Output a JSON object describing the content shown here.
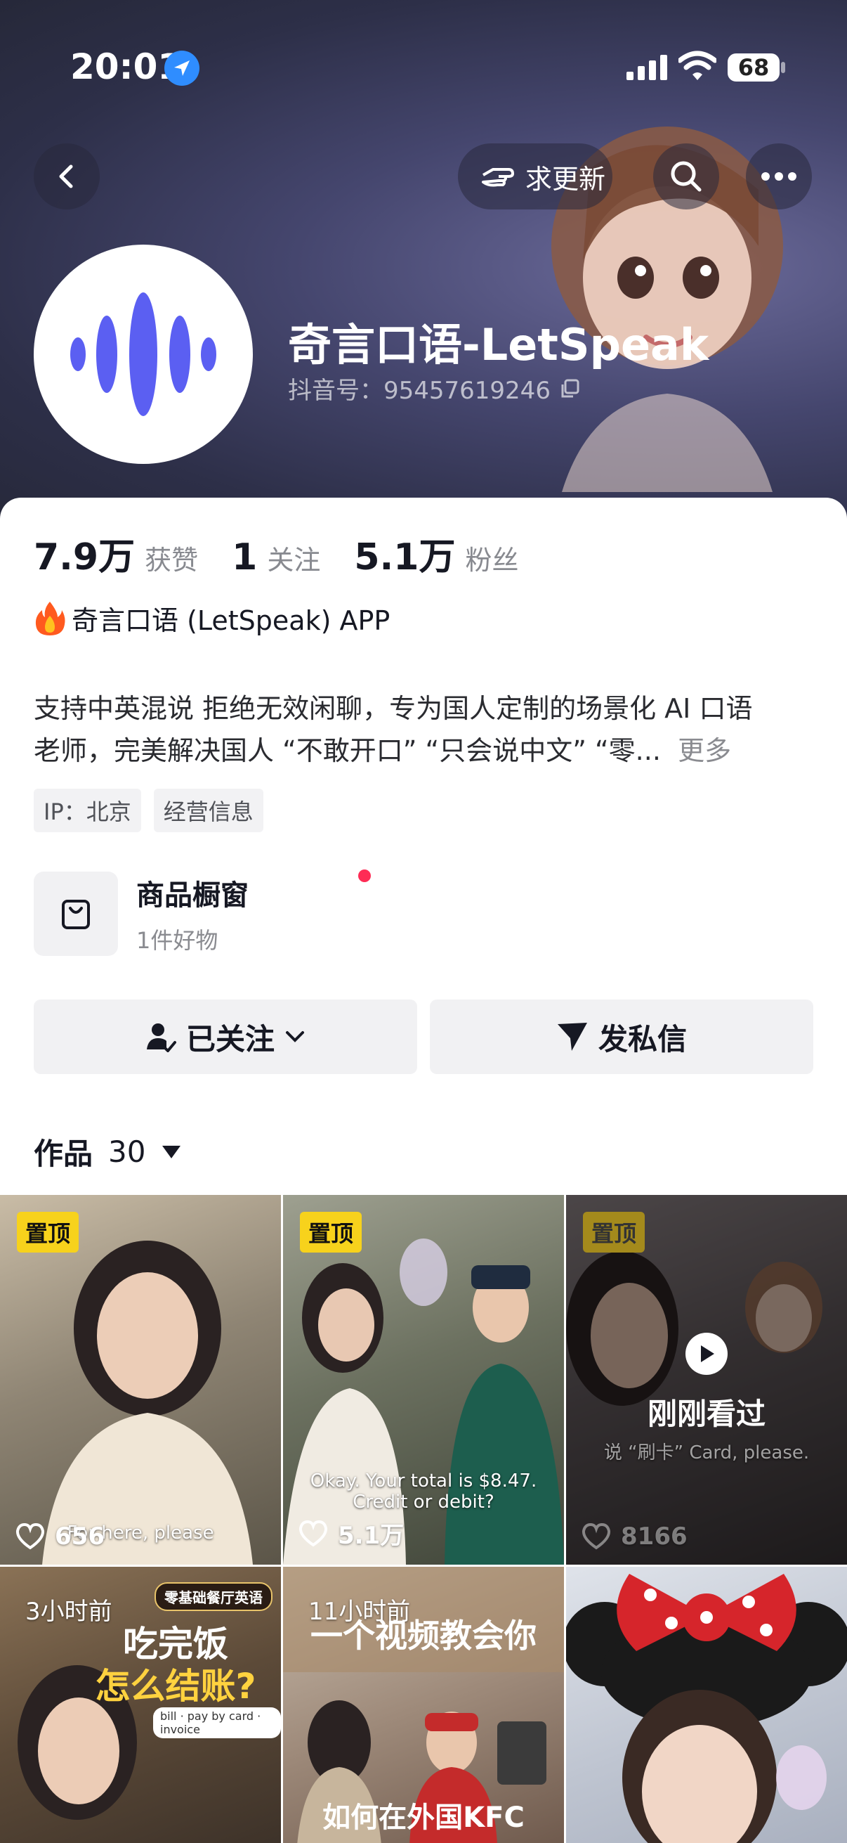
{
  "status": {
    "time": "20:01",
    "battery": "68"
  },
  "nav": {
    "update_label": "求更新"
  },
  "profile": {
    "name": "奇言口语-LetSpeak",
    "douyin_id": "抖音号：95457619246"
  },
  "stats": [
    {
      "num": "7.9万",
      "label": "获赞"
    },
    {
      "num": "1",
      "label": "关注"
    },
    {
      "num": "5.1万",
      "label": "粉丝"
    }
  ],
  "promo": "奇言口语 (LetSpeak) APP",
  "bio": {
    "line1": "支持中英混说 拒绝无效闲聊，专为国人定制的场景化 AI 口语",
    "line2": "老师，完美解决国人 “不敢开口” “只会说中文” “零...",
    "more": "更多"
  },
  "tags": [
    "IP：北京",
    "经营信息"
  ],
  "shop": {
    "title": "商品橱窗",
    "sub": "1件好物"
  },
  "actions": {
    "follow": "已关注",
    "message": "发私信"
  },
  "works": {
    "label": "作品",
    "count": "30"
  },
  "videos": [
    {
      "pin": "置顶",
      "likes": "656",
      "subtitle": "For here, please",
      "colors": [
        "#b9aa94",
        "#6d6a5e"
      ]
    },
    {
      "pin": "置顶",
      "likes": "5.1万",
      "subtitle": "Okay. Your total is $8.47. Credit or debit?",
      "colors": [
        "#8b8d7f",
        "#4a4f45"
      ]
    },
    {
      "pin": "置顶",
      "likes": "8166",
      "watched": "刚刚看过",
      "subtitle": "说 “刷卡” Card, please.",
      "colors": [
        "#6d6466",
        "#3e3a3c"
      ]
    },
    {
      "time": "3小时前",
      "badge": "零基础餐厅英语",
      "title_a": "吃完饭",
      "title_b": "怎么结账?",
      "caption": "bill · pay by card · invoice",
      "colors": [
        "#8a7256",
        "#3d3229"
      ]
    },
    {
      "time": "11小时前",
      "title_top": "一个视频教会你",
      "title_bottom": "如何在外国KFC",
      "colors": [
        "#b3a89a",
        "#6f5a4d"
      ]
    },
    {
      "colors": [
        "#cfd3dc",
        "#a9b0bf"
      ]
    }
  ]
}
